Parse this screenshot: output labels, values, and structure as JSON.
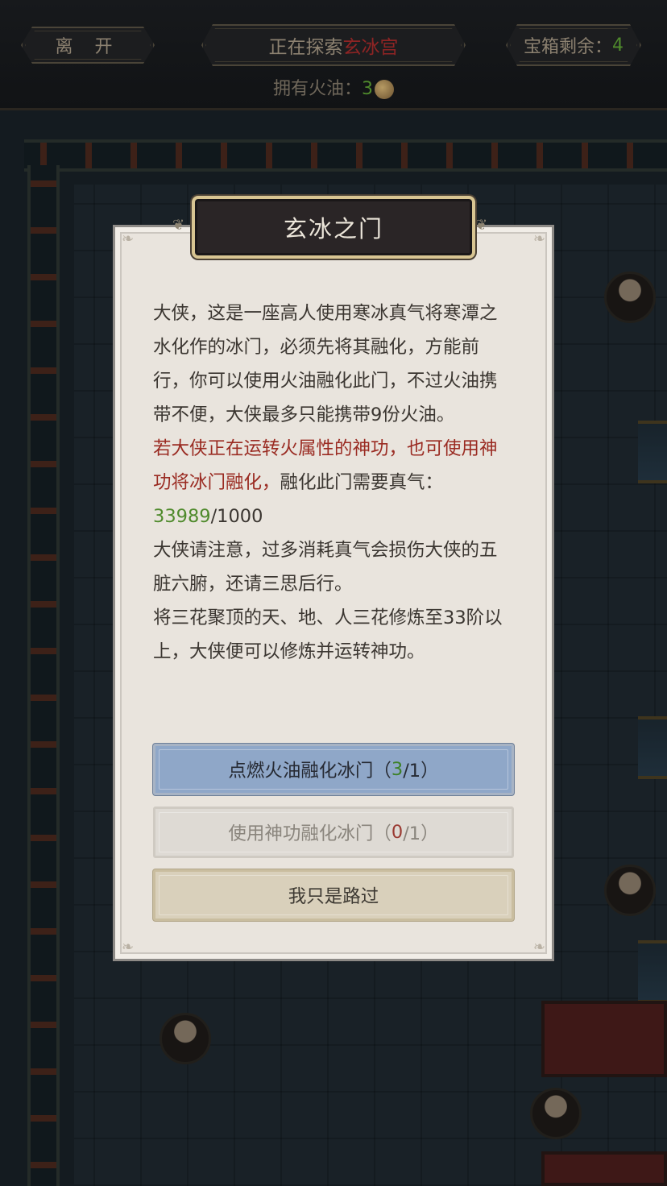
{
  "topbar": {
    "leave_label": "离 开",
    "exploring_prefix": "正在探索",
    "exploring_location": "玄冰宫",
    "chest_prefix": "宝箱剩余：",
    "chest_count": "4",
    "oil_prefix": "拥有火油：",
    "oil_count": "3",
    "oil_icon": "gourd-icon"
  },
  "dialog": {
    "title": "玄冰之门",
    "para1": "大侠，这是一座高人使用寒冰真气将寒潭之水化作的冰门，必须先将其融化，方能前行，你可以使用火油融化此门，不过火油携带不便，大侠最多只能携带9份火油。",
    "para2_red": "若大侠正在运转火属性的神功，也可使用神功将冰门融化，",
    "para2_rest": "融化此门需要真气：",
    "qi_current": "33989",
    "qi_required": "/1000",
    "para3": "大侠请注意，过多消耗真气会损伤大侠的五脏六腑，还请三思后行。",
    "para4": "将三花聚顶的天、地、人三花修炼至33阶以上，大侠便可以修炼并运转神功。",
    "btn_ignite_label": "点燃火油融化冰门（",
    "btn_ignite_have": "3",
    "btn_ignite_need": "/1）",
    "btn_skill_label": "使用神功融化冰门（",
    "btn_skill_have": "0",
    "btn_skill_need": "/1）",
    "btn_pass_label": "我只是路过"
  },
  "colors": {
    "accent_green": "#4f8a2c",
    "accent_red": "#9a2b22",
    "primary_button": "#8fa7c8",
    "title_plate": "#2a2526"
  }
}
